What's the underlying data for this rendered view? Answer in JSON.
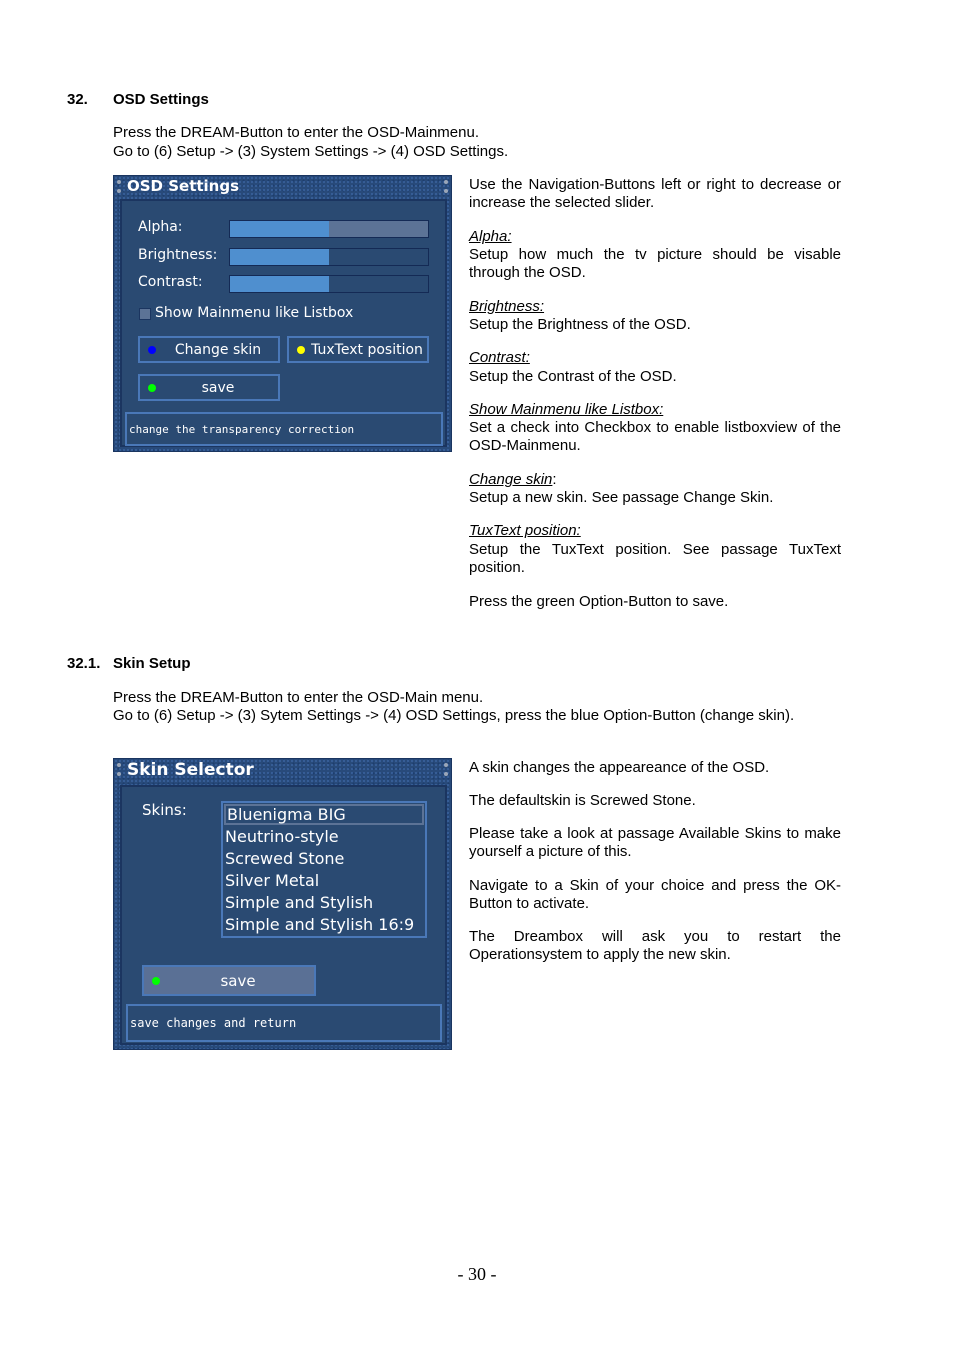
{
  "section1": {
    "number": "32.",
    "title": "OSD Settings",
    "intro": [
      "Press the DREAM-Button to enter the OSD-Mainmenu.",
      "Go to (6) Setup -> (3) System Settings -> (4) OSD Settings."
    ],
    "screenshot": {
      "title": "OSD Settings",
      "sliders": [
        {
          "label": "Alpha:",
          "value_fraction": 0.5
        },
        {
          "label": "Brightness:",
          "value_fraction": 0.5
        },
        {
          "label": "Contrast:",
          "value_fraction": 0.5
        }
      ],
      "checkbox": {
        "label": "Show Mainmenu like Listbox",
        "checked": false
      },
      "buttons": [
        {
          "label": "Change skin",
          "dot_color": "#0000ff"
        },
        {
          "label": "TuxText position",
          "dot_color": "#ffff00"
        },
        {
          "label": "save",
          "dot_color": "#00ff00"
        }
      ],
      "status": "change the transparency correction"
    },
    "description": {
      "intro": "Use the Navigation-Buttons left or right to decrease or increase the selected slider.",
      "items": [
        {
          "term": "Alpha:",
          "text": "Setup how much the tv picture should be visable through the OSD."
        },
        {
          "term": "Brightness:",
          "text": "Setup the Brightness of the OSD."
        },
        {
          "term": "Contrast:",
          "text": "Setup the Contrast of the OSD."
        },
        {
          "term": "Show Mainmenu like Listbox:",
          "text": "Set a check into Checkbox to enable listboxview of the OSD-Mainmenu."
        },
        {
          "term": "Change skin",
          "term_suffix": ":",
          "text": "Setup a new skin. See passage Change Skin."
        },
        {
          "term": "TuxText position:",
          "text": "Setup the TuxText position. See passage TuxText position."
        }
      ],
      "outro": "Press the green Option-Button to save."
    }
  },
  "section2": {
    "number": "32.1.",
    "title": "Skin Setup",
    "intro": [
      "Press the DREAM-Button to enter the OSD-Main menu.",
      "Go to (6) Setup -> (3) Sytem Settings -> (4) OSD Settings, press the blue Option-Button (change skin)."
    ],
    "screenshot": {
      "title": "Skin Selector",
      "skins_label": "Skins:",
      "skins": [
        "Bluenigma BIG",
        "Neutrino-style",
        "Screwed Stone",
        "Silver Metal",
        "Simple and Stylish",
        "Simple and Stylish 16:9"
      ],
      "selected_index": 0,
      "save_button": {
        "label": "save",
        "dot_color": "#00ff00"
      },
      "status": "save changes and return"
    },
    "description": [
      "A skin changes the appeareance of the OSD.",
      "The defaultskin is Screwed Stone.",
      "Please take a look at passage Available Skins to make yourself a picture of this.",
      "Navigate to a Skin of your choice and press the OK-Button to activate.",
      "The Dreambox will ask you to restart the Operationsystem to apply the new skin."
    ]
  },
  "footer": {
    "page_number": "- 30 -"
  }
}
